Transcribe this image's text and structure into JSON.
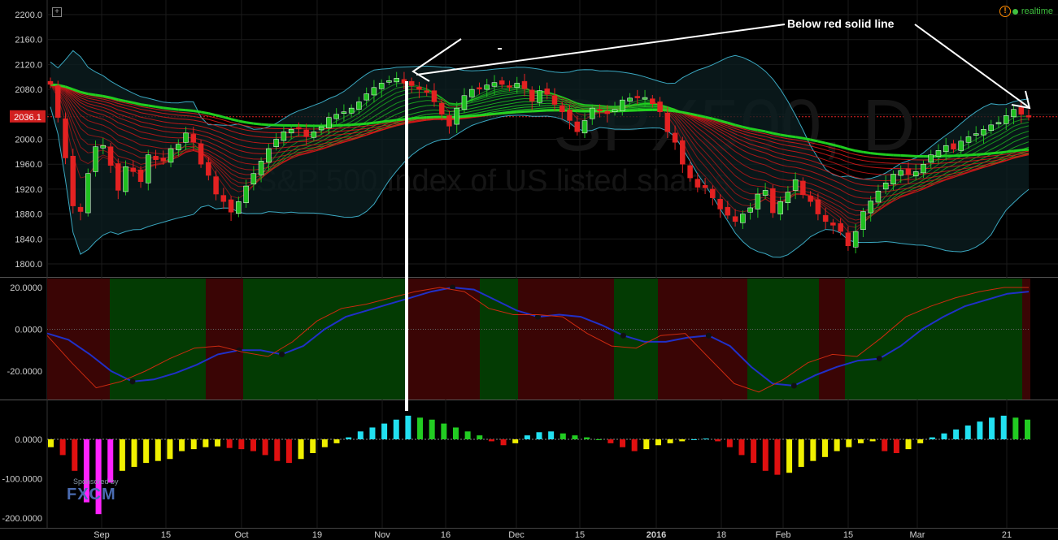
{
  "header": {
    "realtime_label": "realtime",
    "annotation": "Below red solid line",
    "watermark_symbol": "SPX500, D",
    "watermark_desc": "S&P 500 Index of US listed shares",
    "sponsor_text": "Sponsored by",
    "sponsor_brand": "FXCM"
  },
  "colors": {
    "bull": "#1fbf1f",
    "bear": "#e32222",
    "ribbon_up": "#22dd22",
    "ribbon_down": "#e01818",
    "bb": "#3aa7c0",
    "accent": "#ff8a00"
  },
  "chart_data": [
    {
      "type": "candlestick",
      "price_label": "2036.1",
      "ylim": [
        1800,
        2200
      ],
      "yticks": [
        "2200.0",
        "2160.0",
        "2120.0",
        "2080.0",
        "2040.0",
        "2000.0",
        "1960.0",
        "1920.0",
        "1880.0",
        "1840.0",
        "1800.0"
      ],
      "xticks": [
        "Sep",
        "15",
        "Oct",
        "19",
        "Nov",
        "16",
        "Dec",
        "15",
        "2016",
        "18",
        "Feb",
        "15",
        "Mar",
        "21"
      ],
      "close_series": [
        2088,
        2035,
        1970,
        1893,
        1884,
        1945,
        1988,
        1990,
        1958,
        1918,
        1956,
        1948,
        1932,
        1975,
        1967,
        1965,
        1985,
        1992,
        2010,
        1995,
        1960,
        1942,
        1912,
        1900,
        1883,
        1900,
        1925,
        1945,
        1965,
        1985,
        2000,
        2012,
        2016,
        2017,
        2005,
        2012,
        2020,
        2035,
        2040,
        2044,
        2050,
        2060,
        2073,
        2083,
        2090,
        2094,
        2098,
        2090,
        2086,
        2080,
        2075,
        2060,
        2040,
        2021,
        2050,
        2070,
        2080,
        2082,
        2087,
        2091,
        2088,
        2085,
        2090,
        2081,
        2061,
        2078,
        2072,
        2056,
        2044,
        2030,
        2012,
        2030,
        2050,
        2047,
        2041,
        2048,
        2063,
        2066,
        2068,
        2067,
        2057,
        2044,
        2012,
        1995,
        1960,
        1938,
        1923,
        1922,
        1906,
        1888,
        1878,
        1868,
        1880,
        1890,
        1912,
        1918,
        1882,
        1900,
        1915,
        1935,
        1911,
        1900,
        1880,
        1868,
        1862,
        1852,
        1829,
        1852,
        1884,
        1901,
        1917,
        1930,
        1944,
        1950,
        1943,
        1948,
        1960,
        1975,
        1982,
        1990,
        1984,
        1997,
        2004,
        2009,
        2016,
        2023,
        2027,
        2038,
        2048,
        2040,
        2036
      ],
      "ribbon_green_min": [
        1904,
        1906,
        1908,
        1910,
        1912,
        1915,
        1918,
        1921,
        1925,
        1929,
        1934,
        1939,
        1945,
        1952,
        1960,
        1968,
        1976,
        1985,
        1994,
        2003,
        2011,
        2018,
        2024,
        2030,
        2034,
        2036
      ],
      "bb_upper_note": "Bollinger bands drawn around price",
      "annotation_text": "Below red solid line"
    },
    {
      "type": "line",
      "ylim": [
        -35,
        22
      ],
      "yticks": [
        "20.0000",
        "0.0000",
        "-20.0000"
      ],
      "series": [
        {
          "name": "",
          "color": "#2030c8",
          "values": [
            -2,
            -5,
            -12,
            -20,
            -25,
            -24,
            -21,
            -17,
            -12,
            -10,
            -10,
            -12,
            -8,
            0,
            6,
            9,
            12,
            15,
            18,
            20,
            19,
            14,
            9,
            6,
            7,
            6,
            2,
            -3,
            -6,
            -6,
            -4,
            -3,
            -8,
            -18,
            -26,
            -27,
            -22,
            -18,
            -15,
            -14,
            -8,
            0,
            6,
            11,
            14,
            17,
            18
          ]
        },
        {
          "name": "",
          "color": "#cc2a10",
          "values": [
            -3,
            -16,
            -28,
            -25,
            -20,
            -14,
            -9,
            -8,
            -11,
            -13,
            -6,
            4,
            10,
            12,
            15,
            18,
            20,
            18,
            10,
            7,
            7,
            6,
            -2,
            -8,
            -9,
            -3,
            -2,
            -14,
            -26,
            -30,
            -24,
            -16,
            -12,
            -13,
            -4,
            6,
            11,
            15,
            18,
            20,
            20
          ]
        }
      ]
    },
    {
      "type": "bar",
      "ylim": [
        -200,
        75
      ],
      "yticks": [
        "0.0000",
        "-100.0000",
        "-200.0000"
      ],
      "values": [
        -20,
        -40,
        -80,
        -160,
        -190,
        -110,
        -80,
        -70,
        -60,
        -55,
        -50,
        -30,
        -25,
        -20,
        -18,
        -22,
        -25,
        -30,
        -40,
        -55,
        -60,
        -50,
        -35,
        -20,
        -10,
        5,
        20,
        30,
        40,
        50,
        60,
        55,
        50,
        40,
        30,
        20,
        10,
        -5,
        -15,
        -10,
        10,
        18,
        20,
        15,
        10,
        5,
        0,
        -10,
        -20,
        -30,
        -25,
        -15,
        -10,
        -5,
        0,
        2,
        -5,
        -20,
        -40,
        -60,
        -80,
        -90,
        -85,
        -70,
        -55,
        -45,
        -30,
        -20,
        -10,
        -5,
        -30,
        -35,
        -25,
        -10,
        5,
        15,
        25,
        35,
        45,
        55,
        60,
        55,
        50
      ]
    }
  ]
}
